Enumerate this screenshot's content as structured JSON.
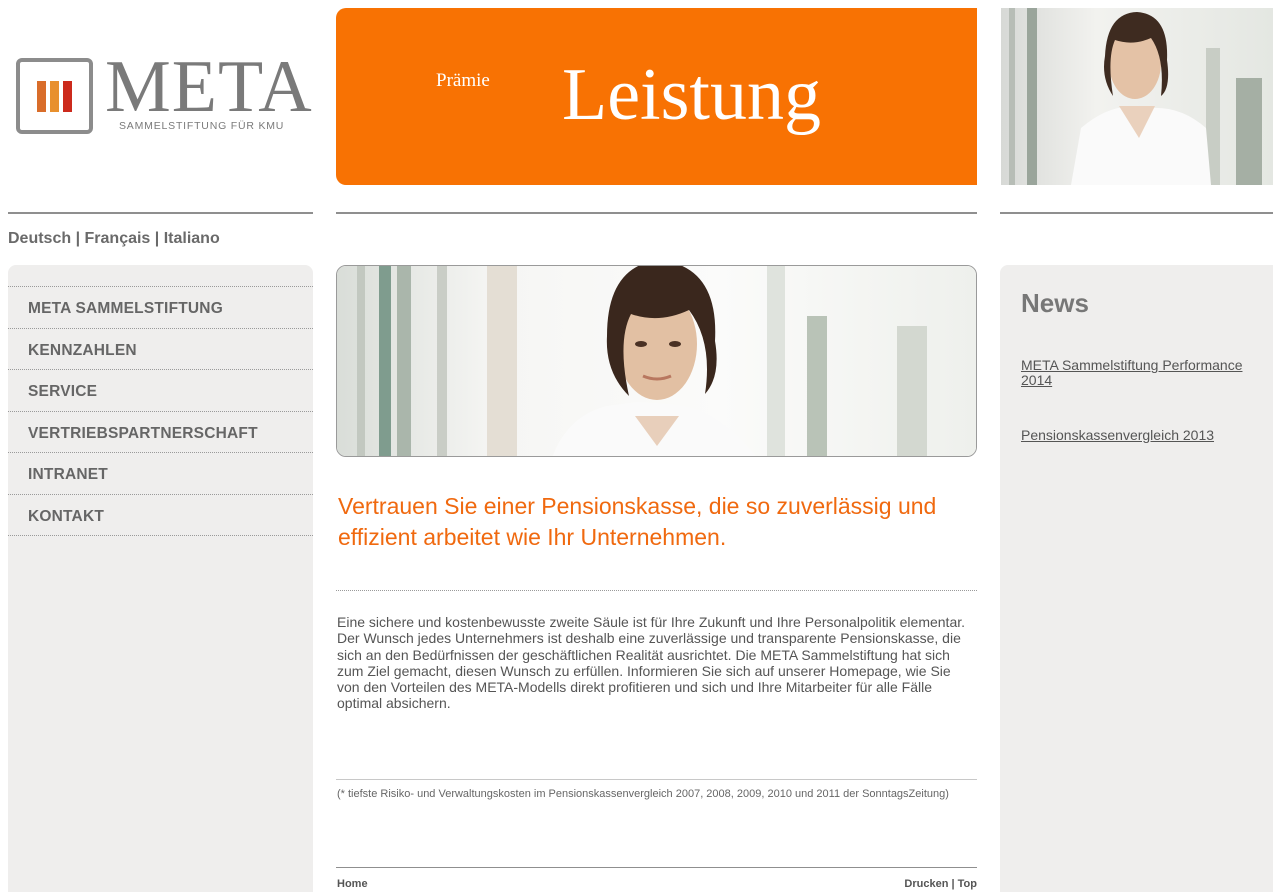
{
  "header": {
    "logo_text": "META",
    "logo_subtitle": "SAMMELSTIFTUNG FÜR KMU",
    "banner_small": "Prämie",
    "banner_big": "Leistung"
  },
  "languages": [
    {
      "label": "Deutsch"
    },
    {
      "label": "Français"
    },
    {
      "label": "Italiano"
    }
  ],
  "language_separator": "|",
  "nav": {
    "items": [
      {
        "label": "META SAMMELSTIFTUNG"
      },
      {
        "label": "KENNZAHLEN"
      },
      {
        "label": "SERVICE"
      },
      {
        "label": "VERTRIEBSPARTNERSCHAFT"
      },
      {
        "label": "INTRANET"
      },
      {
        "label": "KONTAKT"
      }
    ]
  },
  "news": {
    "title": "News",
    "items": [
      {
        "line1": "META Sammelstiftung Performance",
        "line2": "2014"
      },
      {
        "line1": "Pensionskassenvergleich 2013",
        "line2": ""
      }
    ]
  },
  "main": {
    "headline": "Vertrauen Sie einer Pensionskasse, die so zuverlässig und effizient arbeitet wie Ihr Unternehmen.",
    "body": "Eine sichere und kostenbewusste zweite Säule ist für Ihre Zukunft und Ihre Personalpolitik elementar. Der Wunsch jedes Unternehmers ist deshalb eine zuverlässige und transparente Pensionskasse, die sich an den Bedürfnissen der geschäftlichen Realität ausrichtet. Die META Sammelstiftung hat sich zum Ziel gemacht, diesen Wunsch zu erfüllen. Informieren Sie sich auf unserer Homepage, wie Sie von den Vorteilen des META-Modells direkt profitieren und sich und Ihre Mitarbeiter für alle Fälle optimal absichern.",
    "footnote": "(* tiefste Risiko- und Verwaltungskosten im Pensionskassenvergleich 2007, 2008, 2009, 2010 und 2011 der SonntagsZeitung)"
  },
  "footer": {
    "home": "Home",
    "print": "Drucken",
    "separator": "|",
    "top": "Top"
  },
  "colors": {
    "accent": "#f87203",
    "headline": "#f0690f",
    "sidebar_bg": "#efeeed"
  }
}
